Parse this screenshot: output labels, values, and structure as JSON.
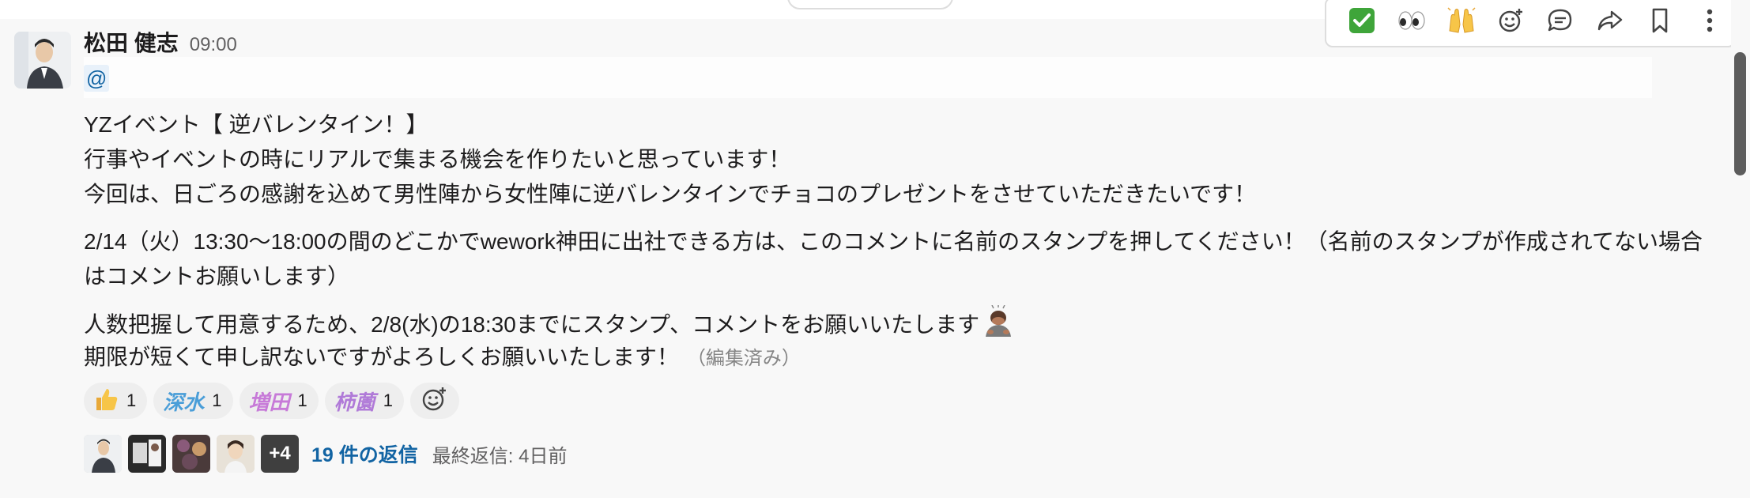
{
  "message": {
    "author": "松田 健志",
    "time": "09:00",
    "mention": "@",
    "lines": [
      "YZイベント【 逆バレンタイン！】",
      "行事やイベントの時にリアルで集まる機会を作りたいと思っています！",
      "今回は、日ごろの感謝を込めて男性陣から女性陣に逆バレンタインでチョコのプレゼントをさせていただきたいです！",
      "2/14（火）13:30〜18:00の間のどこかでwework神田に出社できる方は、このコメントに名前のスタンプを押してください！（名前のスタンプが作成されてない場合",
      "はコメントお願いします）",
      "人数把握して用意するため、2/8(水)の18:30までにスタンプ、コメントをお願いいたします",
      "期限が短くて申し訳ないですがよろしくお願いいたします！"
    ],
    "edited": "（編集済み）",
    "bow_emoji": "person-bowing-icon"
  },
  "reactions": [
    {
      "icon": "thumbs-up-icon",
      "count": "1"
    },
    {
      "stamp": "深水",
      "color": "#4a9ed8",
      "count": "1"
    },
    {
      "stamp": "増田",
      "color": "#c77ad8",
      "count": "1"
    },
    {
      "stamp": "柿薗",
      "color": "#b07ad8",
      "count": "1"
    }
  ],
  "thread": {
    "more": "+4",
    "reply_count": "19 件の返信",
    "last_reply": "最終返信: 4日前"
  },
  "toolbar": {
    "items": [
      "check-mark-icon",
      "eyes-icon",
      "raised-hands-icon",
      "add-reaction-icon",
      "reply-in-thread-icon",
      "share-icon",
      "bookmark-icon",
      "more-actions-icon"
    ]
  },
  "colors": {
    "link": "#1264a3",
    "background": "#f8f8f8",
    "check_green": "#3fa53a"
  }
}
